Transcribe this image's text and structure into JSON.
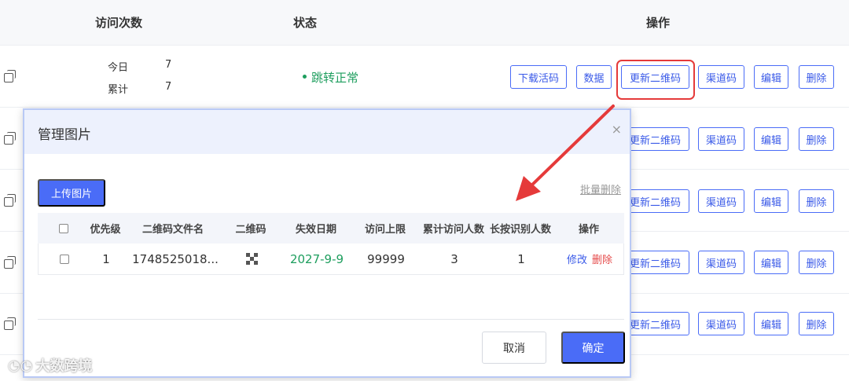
{
  "table": {
    "headers": {
      "visits": "访问次数",
      "status": "状态",
      "actions": "操作"
    },
    "first_row": {
      "today_label": "今日",
      "today_value": "7",
      "total_label": "累计",
      "total_value": "7",
      "status": "跳转正常"
    },
    "action_buttons": {
      "download": "下载活码",
      "data": "数据",
      "update_qr": "更新二维码",
      "channel": "渠道码",
      "edit": "编辑",
      "delete": "删除"
    }
  },
  "modal": {
    "title": "管理图片",
    "close": "×",
    "upload_label": "上传图片",
    "batch_delete_label": "批量删除",
    "columns": [
      "优先级",
      "二维码文件名",
      "二维码",
      "失效日期",
      "访问上限",
      "累计访问人数",
      "长按识别人数",
      "操作"
    ],
    "rows": [
      {
        "priority": "1",
        "filename": "1748525018...",
        "expiry": "2027-9-9",
        "limit": "99999",
        "visits": "3",
        "scans": "1",
        "edit_label": "修改",
        "delete_label": "删除"
      }
    ],
    "cancel_label": "取消",
    "confirm_label": "确定"
  },
  "watermark": "大数跨境",
  "colors": {
    "accent": "#4a6cf7",
    "success": "#1e9e5e",
    "danger": "#e53a3a"
  },
  "icons": [
    "copy-icon",
    "qr-code-icon",
    "close-icon"
  ]
}
